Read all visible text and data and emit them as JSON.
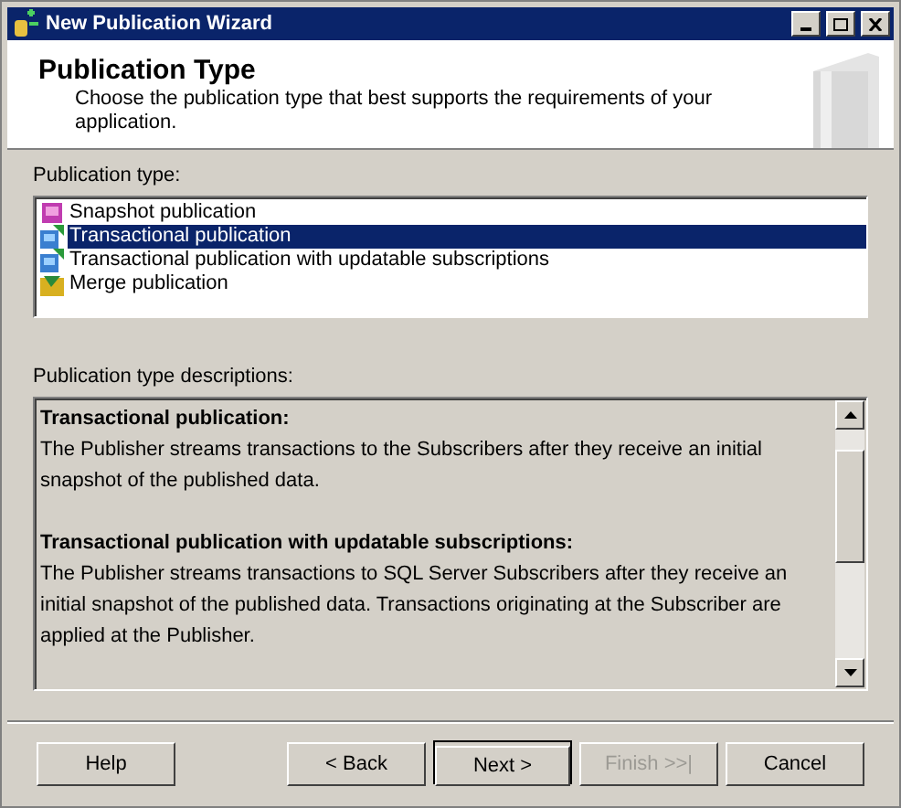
{
  "window": {
    "title": "New Publication Wizard"
  },
  "header": {
    "title": "Publication Type",
    "subtitle": "Choose the publication type that best supports the requirements of your application."
  },
  "publication_types": {
    "label": "Publication type:",
    "items": [
      {
        "label": "Snapshot publication",
        "kind": "snapshot",
        "selected": false
      },
      {
        "label": "Transactional publication",
        "kind": "transactional",
        "selected": true
      },
      {
        "label": "Transactional publication with updatable subscriptions",
        "kind": "transactional",
        "selected": false
      },
      {
        "label": "Merge publication",
        "kind": "merge",
        "selected": false
      }
    ]
  },
  "descriptions": {
    "label": "Publication type descriptions:",
    "sections": [
      {
        "heading": "Transactional publication:",
        "text": "The Publisher streams transactions to the Subscribers after they receive an initial snapshot of the published data."
      },
      {
        "heading": "Transactional publication with updatable subscriptions:",
        "text": "The Publisher streams transactions to SQL Server Subscribers after they receive an initial snapshot of the published data. Transactions originating at the Subscriber are applied at the Publisher."
      }
    ]
  },
  "buttons": [
    {
      "label": "Help",
      "disabled": false,
      "default": false
    },
    {
      "label": "< Back",
      "disabled": false,
      "default": false
    },
    {
      "label": "Next >",
      "disabled": false,
      "default": true
    },
    {
      "label": "Finish >>|",
      "disabled": true,
      "default": false
    },
    {
      "label": "Cancel",
      "disabled": false,
      "default": false
    }
  ]
}
